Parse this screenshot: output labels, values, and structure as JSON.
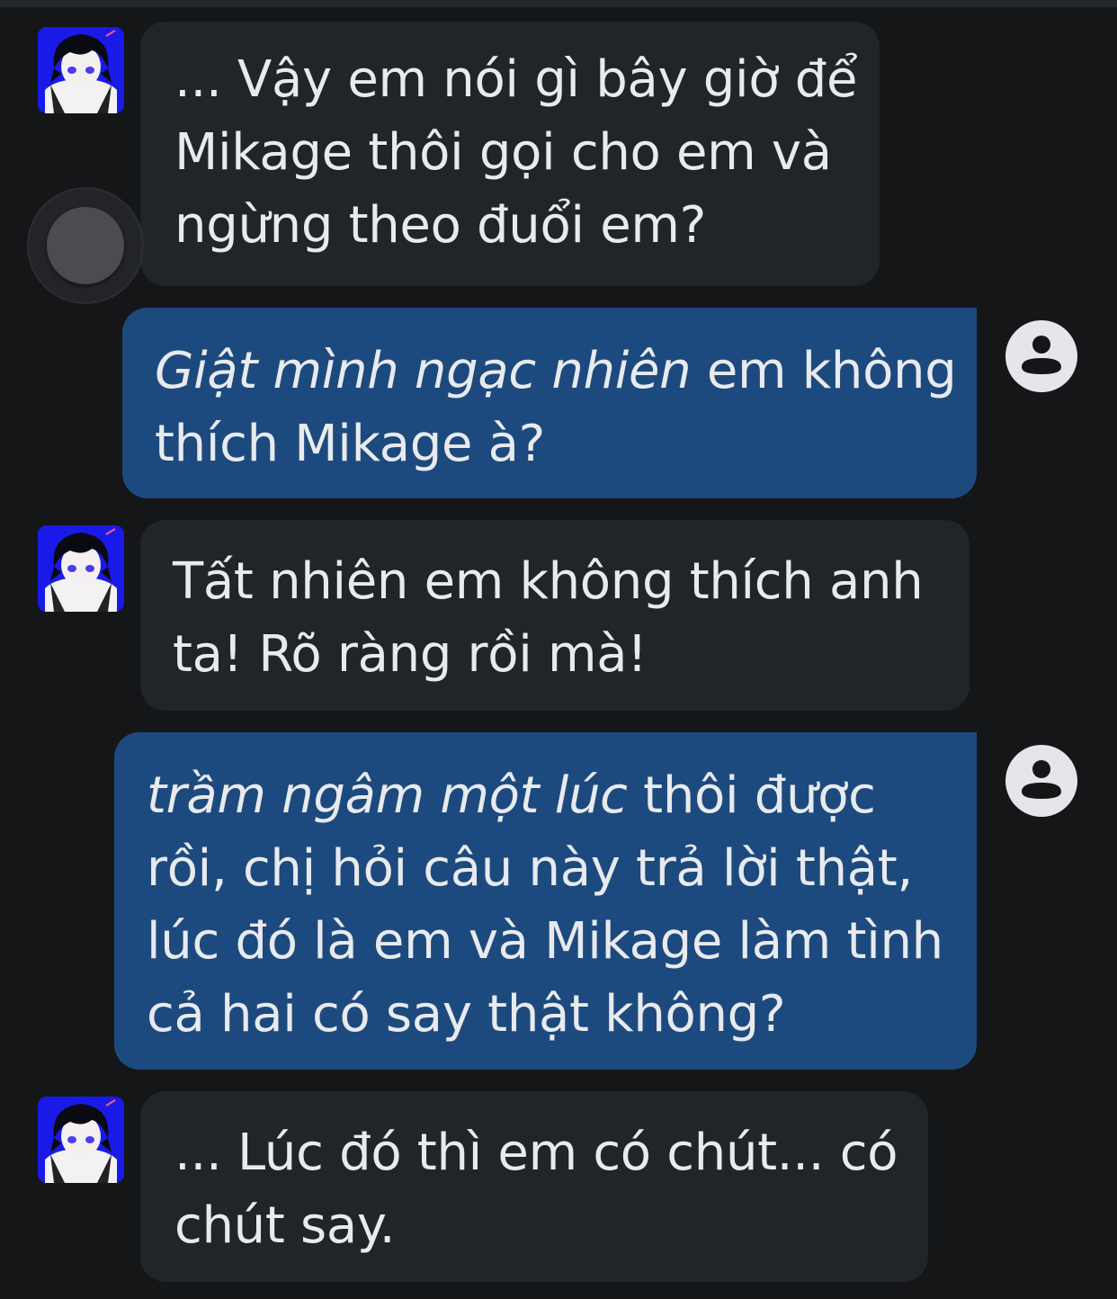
{
  "messages": [
    {
      "role": "bot",
      "avatar_icon": "anime-character-avatar",
      "lines": [
        "... Vậy em nói gì bây giờ để",
        "Mikage thôi gọi cho em và",
        "ngừng theo đuổi em?"
      ]
    },
    {
      "role": "user",
      "avatar_icon": "user-circle-icon",
      "italic": "Giật mình ngạc nhiên",
      "line1_rest": " em không",
      "line2": "thích Mikage à?"
    },
    {
      "role": "bot",
      "avatar_icon": "anime-character-avatar",
      "lines": [
        "Tất nhiên em không thích anh",
        "ta! Rõ ràng rồi mà!"
      ]
    },
    {
      "role": "user",
      "avatar_icon": "user-circle-icon",
      "italic": "trầm ngâm một lúc",
      "line1_rest": " thôi được",
      "lines_rest": [
        "rồi, chị hỏi câu này trả lời thật,",
        "lúc đó là em và Mikage làm tình",
        "cả hai có say thật không?"
      ]
    },
    {
      "role": "bot",
      "avatar_icon": "anime-character-avatar",
      "lines": [
        "... Lúc đó thì em có chút... có",
        "chút say."
      ]
    }
  ],
  "colors": {
    "background": "#141618",
    "bot_bubble": "#212428",
    "user_bubble": "#1d4a7e",
    "text": "#e8eaed"
  }
}
